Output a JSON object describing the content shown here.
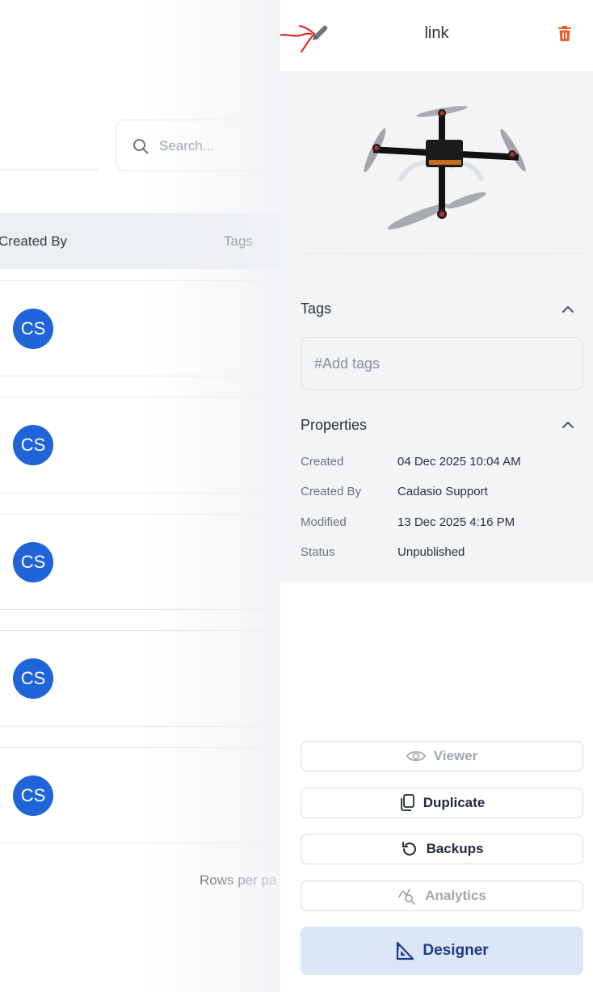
{
  "list": {
    "search_placeholder": "Search...",
    "columns": [
      "Created By",
      "Tags"
    ],
    "rows": [
      {
        "initials": "CS"
      },
      {
        "initials": "CS"
      },
      {
        "initials": "CS"
      },
      {
        "initials": "CS"
      },
      {
        "initials": "CS"
      }
    ],
    "rows_per_page_label": "Rows per pa"
  },
  "panel": {
    "title": "link",
    "edit_icon": "pencil-icon",
    "delete_icon": "trash-icon",
    "tags": {
      "title": "Tags",
      "placeholder": "#Add tags"
    },
    "properties": {
      "title": "Properties",
      "items": [
        {
          "label": "Created",
          "value": "04 Dec 2025 10:04 AM"
        },
        {
          "label": "Created By",
          "value": "Cadasio Support"
        },
        {
          "label": "Modified",
          "value": "13 Dec 2025 4:16 PM"
        },
        {
          "label": "Status",
          "value": "Unpublished"
        }
      ]
    },
    "actions": {
      "viewer": "Viewer",
      "duplicate": "Duplicate",
      "backups": "Backups",
      "analytics": "Analytics",
      "designer": "Designer"
    }
  },
  "colors": {
    "avatar": "#1f64d8",
    "delete": "#f05a2b",
    "annotation_arrow": "#e31b1b",
    "designer_bg": "#dbe6f7",
    "designer_text": "#1e3a8a"
  }
}
